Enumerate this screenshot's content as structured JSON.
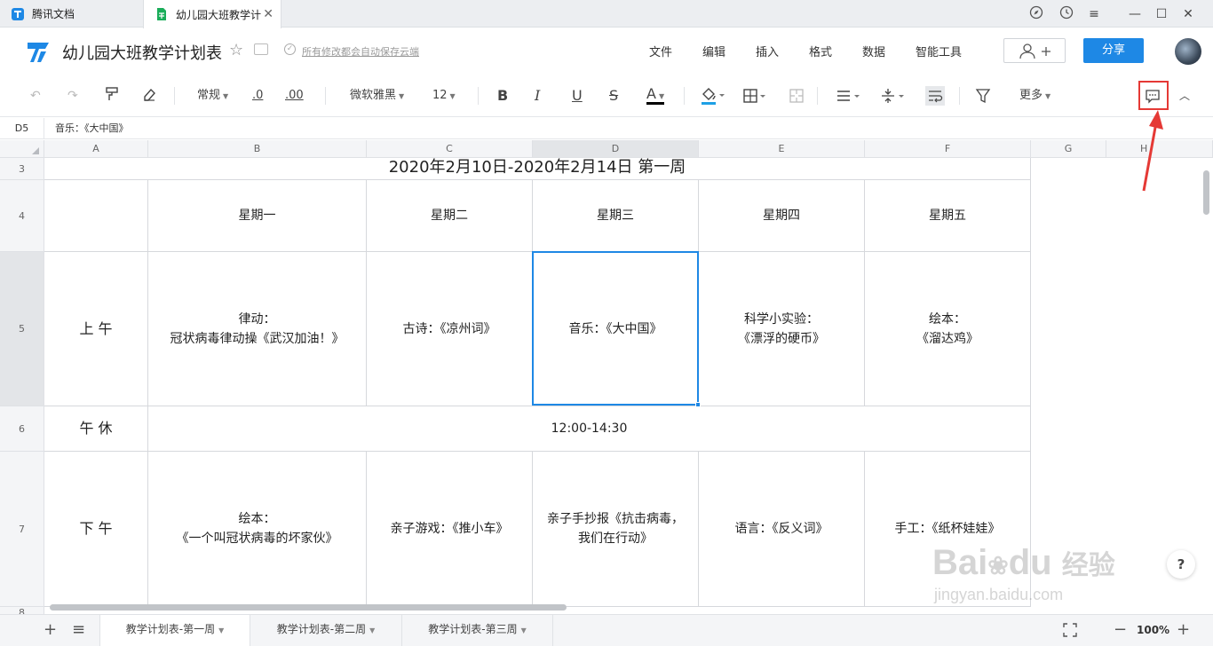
{
  "browser": {
    "tabs": [
      {
        "label": "腾讯文档"
      },
      {
        "label": "幼儿园大班教学计"
      }
    ]
  },
  "header": {
    "title": "幼儿园大班教学计划表",
    "save_status": "所有修改都会自动保存云端",
    "menus": [
      "文件",
      "编辑",
      "插入",
      "格式",
      "数据",
      "智能工具"
    ],
    "share_label": "分享"
  },
  "toolbar": {
    "number_format": "常规",
    "decimal_decrease": ".0",
    "decimal_increase": ".00",
    "font_family": "微软雅黑",
    "font_size": "12",
    "more_label": "更多",
    "bold": "B",
    "italic": "I",
    "underline": "U",
    "strike": "S",
    "font_color_glyph": "A"
  },
  "formula_bar": {
    "cell_ref": "D5",
    "content": "音乐：《大中国》"
  },
  "grid": {
    "columns": [
      "A",
      "B",
      "C",
      "D",
      "E",
      "F",
      "G",
      "H"
    ],
    "rows": [
      "3",
      "4",
      "5",
      "6",
      "7",
      "8"
    ],
    "title": "2020年2月10日-2020年2月14日          第一周",
    "weekdays": [
      "星期一",
      "星期二",
      "星期三",
      "星期四",
      "星期五"
    ],
    "morning_label": "上 午",
    "morning": [
      "律动：\n冠状病毒律动操《武汉加油！》",
      "古诗：《凉州词》",
      "音乐：《大中国》",
      "科学小实验：\n《漂浮的硬币》",
      "绘本：\n《溜达鸡》"
    ],
    "noon_label": "午 休",
    "noon_time": "12:00-14:30",
    "afternoon_label": "下 午",
    "afternoon": [
      "绘本：\n《一个叫冠状病毒的坏家伙》",
      "亲子游戏：《推小车》",
      "亲子手抄报《抗击病毒，\n我们在行动》",
      "语言：《反义词》",
      "手工：《纸杯娃娃》"
    ]
  },
  "sheets": {
    "tabs": [
      "教学计划表-第一周",
      "教学计划表-第二周",
      "教学计划表-第三周"
    ],
    "zoom": "100%"
  },
  "watermark": {
    "brand": "Bai",
    "brand_tail": "du",
    "cn": "经验",
    "url": "jingyan.baidu.com"
  },
  "help": {
    "label": "?"
  },
  "colors": {
    "accent": "#1e88e5",
    "annotation": "#e53935",
    "sheet_icon_green": "#1aad5a"
  }
}
